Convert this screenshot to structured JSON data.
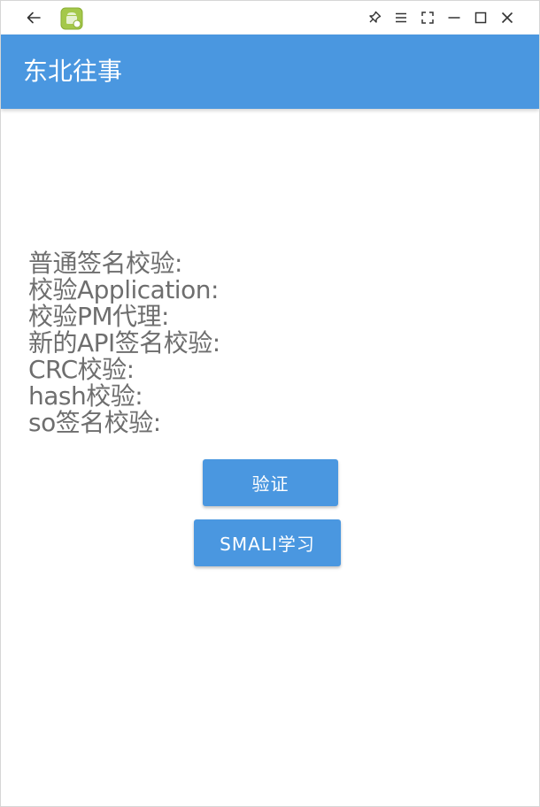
{
  "titlebar": {
    "back_icon": "arrow-left-icon",
    "app_icon": "android-app-icon",
    "pin_icon": "pin-icon",
    "menu_icon": "menu-icon",
    "fullscreen_icon": "fullscreen-icon",
    "minimize_icon": "minimize-icon",
    "maximize_icon": "maximize-icon",
    "close_icon": "close-icon"
  },
  "appbar": {
    "title": "东北往事",
    "color": "#4a97e0"
  },
  "checks": [
    "普通签名校验:",
    "校验Application:",
    "校验PM代理:",
    "新的API签名校验:",
    "CRC校验:",
    "hash校验:",
    "so签名校验:"
  ],
  "buttons": {
    "verify_label": "验证",
    "smali_label": "SMALI学习"
  }
}
